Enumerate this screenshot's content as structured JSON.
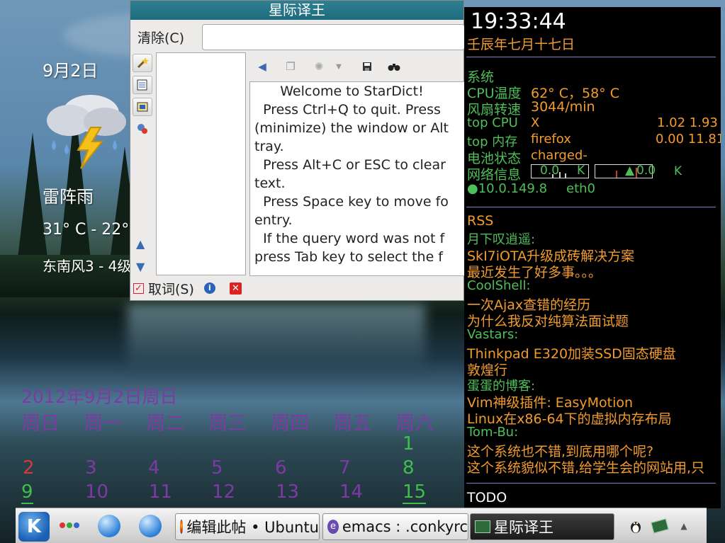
{
  "weather": {
    "date": "9月2日",
    "icon": "thunderstorm-icon",
    "condition": "雷阵雨",
    "temperature": "31° C - 22°",
    "wind": "东南风3 - 4级"
  },
  "calendar": {
    "title": "2012年9月2日周日",
    "weekdays": [
      "周日",
      "周一",
      "周二",
      "周三",
      "周四",
      "周五",
      "周六"
    ],
    "rows": [
      [
        "",
        "",
        "",
        "",
        "",
        "",
        "1"
      ],
      [
        "2",
        "3",
        "4",
        "5",
        "6",
        "7",
        "8"
      ],
      [
        "9",
        "10",
        "11",
        "12",
        "13",
        "14",
        "15"
      ]
    ],
    "colors": {
      "text": "#7d3aa5",
      "sunday": "#d13b3b",
      "saturday": "#3fbf4a"
    }
  },
  "stardict": {
    "title": "星际译王",
    "clear_label": "清除(C)",
    "search_value": "",
    "toolbar_icons": [
      "speaker-icon",
      "copy-icon",
      "gear-icon",
      "save-icon",
      "binoculars-icon"
    ],
    "side_icons": [
      "magic-wand-icon",
      "dict-list-icon",
      "dict-manage-icon",
      "network-dict-icon"
    ],
    "definition": [
      "      Welcome to StarDict!",
      "",
      "  Press Ctrl+Q to quit. Press",
      "(minimize) the window or Alt",
      "tray.",
      "  Press Alt+C or ESC to clear",
      "text.",
      "  Press Space key to move fo",
      "entry.",
      "  If the query word was not f",
      "press Tab key to select the f"
    ],
    "scan_label": "取词(S)",
    "scan_checked": true
  },
  "conky": {
    "time": "19:33:44",
    "lunar_date": "壬辰年七月十七日",
    "system_header": "系统",
    "cpu_temp_label": "CPU温度",
    "cpu_temp_value": "62° C，58° C",
    "fan_label": "风扇转速",
    "fan_value": "3044/min",
    "top_cpu_label": "top CPU",
    "top_cpu_proc": "X",
    "top_cpu_vals": "1.02 1.93",
    "top_mem_label": "top 内存",
    "top_mem_proc": "firefox",
    "top_mem_vals": "0.00 11.81",
    "battery_label": "电池状态",
    "battery_value": "charged-",
    "network_label": "网络信息",
    "down_speed": "0.0",
    "down_unit": "K",
    "up_speed": "0.0",
    "up_unit": "K",
    "ip": "●10.0.149.8",
    "iface": "eth0",
    "rss_header": "RSS",
    "feeds": [
      {
        "name": "月下叹逍遥:",
        "items": [
          "SkI7iOTA升级成砖解决方案",
          "最近发生了好多事。。。"
        ]
      },
      {
        "name": "CoolShell:",
        "items": [
          "一次Ajax查错的经历",
          "为什么我反对纯算法面试题"
        ]
      },
      {
        "name": "Vastars:",
        "items": [
          "Thinkpad E320加装SSD固态硬盘",
          "敦煌行"
        ]
      },
      {
        "name": "蛋蛋的博客:",
        "items": [
          "Vim神级插件: EasyMotion",
          "Linux在x86-64下的虚拟内存布局"
        ]
      },
      {
        "name": "Tom-Bu:",
        "items": [
          "这个系统也不错,到底用哪个呢?",
          "这个系统貌似不错,给学生会的网站用,只"
        ]
      }
    ],
    "todo_header": "TODO",
    "colors": {
      "label": "#f29b2d",
      "accent": "#4fbf5a",
      "rule": "#7a7fc8"
    }
  },
  "taskbar": {
    "kmenu_icon": "kde-menu-icon",
    "tasks": [
      {
        "label": "编辑此帖 • Ubuntu",
        "icon": "firefox-icon"
      },
      {
        "label": "emacs : .conkyrc",
        "icon": "emacs-icon"
      },
      {
        "label": "星际译王",
        "icon": "stardict-icon"
      }
    ],
    "tray_icons": [
      "tux-icon",
      "stardict-tray-icon",
      "expand-arrow-icon"
    ]
  }
}
